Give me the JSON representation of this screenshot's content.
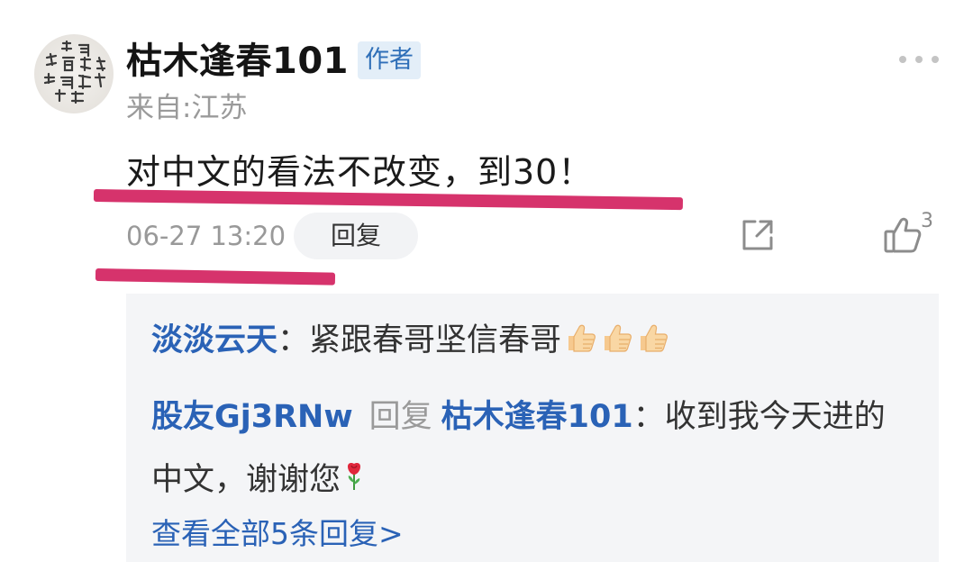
{
  "post": {
    "username": "枯木逢春101",
    "author_badge": "作者",
    "location": "来自:江苏",
    "comment": "对中文的看法不改变，到30！",
    "timestamp": "06-27 13:20",
    "reply_label": "回复",
    "like_count": "3",
    "avatar_icon": "calligraphy-avatar",
    "more_icon": "more-dots-icon",
    "share_icon": "share-icon",
    "like_icon": "thumbs-up-icon",
    "highlight_color": "#d6336c"
  },
  "replies": [
    {
      "author": "淡淡云天",
      "separator": "：",
      "text": "紧跟春哥坚信春哥",
      "emoji": [
        "thumbs-up-emoji",
        "thumbs-up-emoji",
        "thumbs-up-emoji"
      ]
    },
    {
      "author": "股友Gj3RNw",
      "reply_word": "回复",
      "reply_to": "枯木逢春101",
      "separator": "：",
      "text": "收到我今天进的中文，谢谢您",
      "emoji": [
        "rose-emoji"
      ]
    }
  ],
  "view_all": "查看全部5条回复>"
}
